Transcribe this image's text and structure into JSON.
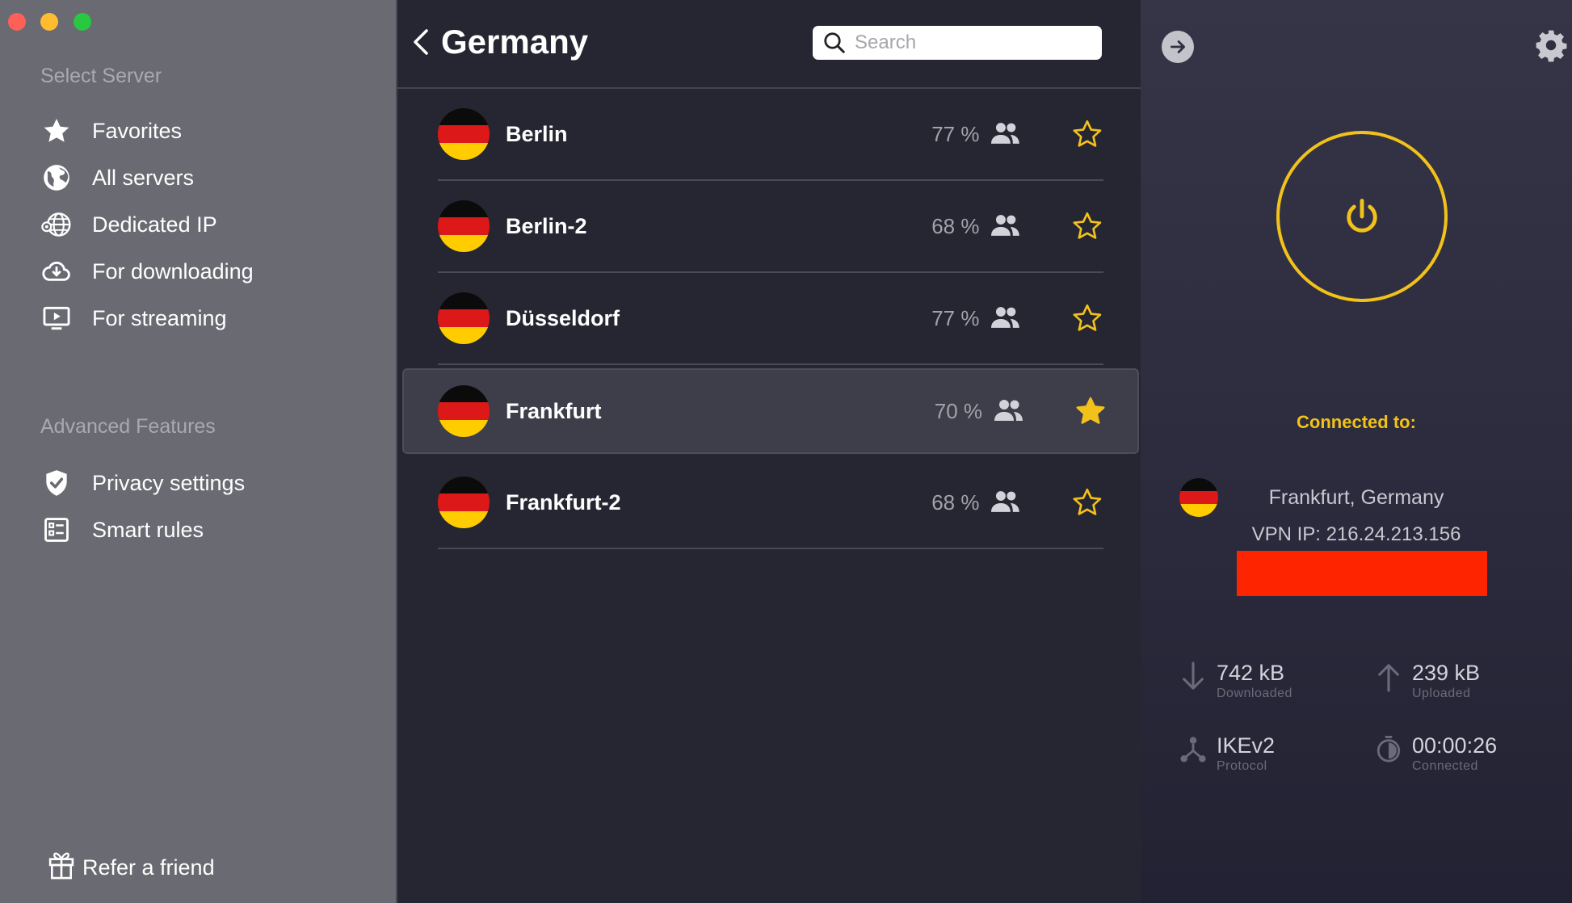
{
  "sidebar": {
    "select_server_title": "Select Server",
    "items": [
      {
        "label": "Favorites",
        "icon": "star-icon"
      },
      {
        "label": "All servers",
        "icon": "globe-icon"
      },
      {
        "label": "Dedicated IP",
        "icon": "dedicated-ip-icon"
      },
      {
        "label": "For downloading",
        "icon": "cloud-download-icon"
      },
      {
        "label": "For streaming",
        "icon": "play-screen-icon"
      }
    ],
    "advanced_title": "Advanced Features",
    "advanced_items": [
      {
        "label": "Privacy settings",
        "icon": "shield-check-icon"
      },
      {
        "label": "Smart rules",
        "icon": "rules-list-icon"
      }
    ],
    "refer_label": "Refer a friend"
  },
  "header": {
    "title": "Germany",
    "search_placeholder": "Search"
  },
  "servers": [
    {
      "name": "Berlin",
      "load": "77 %",
      "favorite": false
    },
    {
      "name": "Berlin-2",
      "load": "68 %",
      "favorite": false
    },
    {
      "name": "Düsseldorf",
      "load": "77 %",
      "favorite": false
    },
    {
      "name": "Frankfurt",
      "load": "70 %",
      "favorite": true,
      "selected": true
    },
    {
      "name": "Frankfurt-2",
      "load": "68 %",
      "favorite": false
    }
  ],
  "connection": {
    "connected_label": "Connected to:",
    "location": "Frankfurt, Germany",
    "vpn_ip": "VPN IP: 216.24.213.156",
    "downloaded_value": "742 kB",
    "downloaded_label": "Downloaded",
    "uploaded_value": "239 kB",
    "uploaded_label": "Uploaded",
    "protocol_value": "IKEv2",
    "protocol_label": "Protocol",
    "connected_time": "00:00:26",
    "connected_time_label": "Connected"
  },
  "colors": {
    "accent": "#f2c21b",
    "sidebar_bg": "#6a6a72",
    "panel_bg": "#262632",
    "redaction": "#ff2400"
  }
}
